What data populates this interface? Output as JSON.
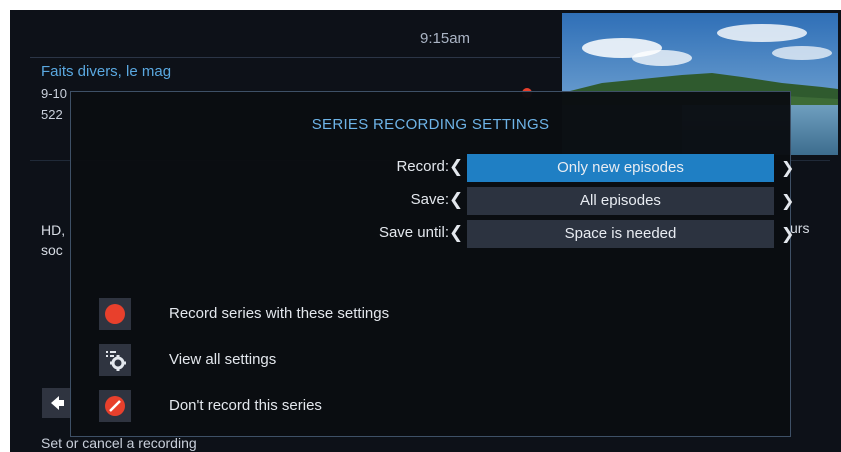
{
  "background": {
    "time": "9:15am",
    "program_title": "Faits divers, le mag",
    "program_line2": "9-10",
    "program_line3": "522",
    "description_left": "HD, soc",
    "description_right": "urs",
    "footer_hint": "Set or cancel a recording"
  },
  "dialog": {
    "title": "SERIES RECORDING SETTINGS",
    "settings": [
      {
        "label": "Record:",
        "value": "Only new episodes",
        "selected": true
      },
      {
        "label": "Save:",
        "value": "All episodes",
        "selected": false
      },
      {
        "label": "Save until:",
        "value": "Space is needed",
        "selected": false
      }
    ],
    "actions": [
      {
        "label": "Record series with these settings",
        "icon": "record-icon"
      },
      {
        "label": "View all settings",
        "icon": "settings-gear-icon"
      },
      {
        "label": "Don't record this series",
        "icon": "no-record-icon"
      }
    ]
  },
  "colors": {
    "accent": "#1f7fc4",
    "title_blue": "#6eb4e8",
    "record_red": "#e8402c"
  }
}
